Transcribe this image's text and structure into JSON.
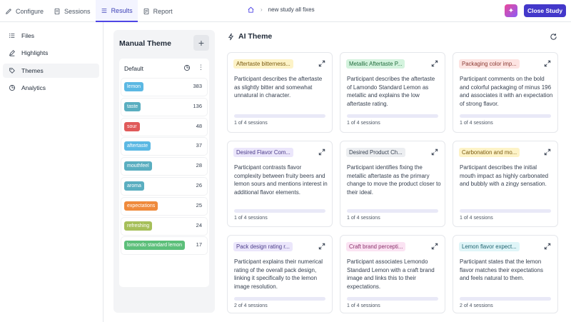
{
  "nav": {
    "tabs": [
      {
        "label": "Configure"
      },
      {
        "label": "Sessions"
      },
      {
        "label": "Results"
      },
      {
        "label": "Report"
      }
    ]
  },
  "breadcrumb": {
    "study": "new study all fixes"
  },
  "header": {
    "close_label": "Close Study"
  },
  "sidebar": {
    "items": [
      {
        "label": "Files"
      },
      {
        "label": "Highlights"
      },
      {
        "label": "Themes"
      },
      {
        "label": "Analytics"
      }
    ]
  },
  "manual": {
    "title": "Manual Theme",
    "add": "+",
    "group": "Default",
    "tags": [
      {
        "label": "lemon",
        "count": "383",
        "color": "#5bb8e3"
      },
      {
        "label": "taste",
        "count": "136",
        "color": "#5aaec0"
      },
      {
        "label": "sour",
        "count": "48",
        "color": "#e05a5a"
      },
      {
        "label": "aftertaste",
        "count": "37",
        "color": "#5bb8e3"
      },
      {
        "label": "mouthfeel",
        "count": "28",
        "color": "#5aaec0"
      },
      {
        "label": "aroma",
        "count": "26",
        "color": "#5aaec0"
      },
      {
        "label": "expectations",
        "count": "25",
        "color": "#ef8a3c"
      },
      {
        "label": "refreshing",
        "count": "24",
        "color": "#a6bf5a"
      },
      {
        "label": "lomondo standard lemon",
        "count": "17",
        "color": "#5cbf7a"
      }
    ]
  },
  "ai": {
    "title": "AI Theme",
    "cards": [
      {
        "label": "Aftertaste bitterness...",
        "label_bg": "#fdf3c7",
        "label_color": "#7a5a10",
        "desc": "Participant describes the aftertaste as slightly bitter and somewhat unnatural in character.",
        "sessions": "1 of 4 sessions"
      },
      {
        "label": "Metallic Aftertaste P...",
        "label_bg": "#d4f3de",
        "label_color": "#1f6b3b",
        "desc": "Participant describes the aftertaste of Lamondo Standard Lemon as metallic and explains the low aftertaste rating.",
        "sessions": "1 of 4 sessions"
      },
      {
        "label": "Packaging color imp...",
        "label_bg": "#fde4e2",
        "label_color": "#8a3a33",
        "desc": "Participant comments on the bold and colorful packaging of minus 196 and associates it with an expectation of strong flavor.",
        "sessions": "1 of 4 sessions"
      },
      {
        "label": "Desired Flavor Com...",
        "label_bg": "#ebe6fb",
        "label_color": "#4b3c8a",
        "desc": "Participant contrasts flavor complexity between fruity beers and lemon sours and mentions interest in additional flavor elements.",
        "sessions": "1 of 4 sessions"
      },
      {
        "label": "Desired Product Ch...",
        "label_bg": "#eceef1",
        "label_color": "#374151",
        "desc": "Participant identifies fixing the metallic aftertaste as the primary change to move the product closer to their ideal.",
        "sessions": "1 of 4 sessions"
      },
      {
        "label": "Carbonation and mo...",
        "label_bg": "#fdf3c7",
        "label_color": "#7a5a10",
        "desc": "Participant describes the initial mouth impact as highly carbonated and bubbly with a zingy sensation.",
        "sessions": "1 of 4 sessions"
      },
      {
        "label": "Pack design rating r...",
        "label_bg": "#ebe6fb",
        "label_color": "#4b3c8a",
        "desc": "Participant explains their numerical rating of the overall pack design, linking it specifically to the lemon image resolution.",
        "sessions": "2 of 4 sessions"
      },
      {
        "label": "Craft brand percepti...",
        "label_bg": "#fbe3f3",
        "label_color": "#8a2f6a",
        "desc": "Participant associates Lemondo Standard Lemon with a craft brand image and links this to their expectations.",
        "sessions": "1 of 4 sessions"
      },
      {
        "label": "Lemon flavor expect...",
        "label_bg": "#dff5f8",
        "label_color": "#1f6470",
        "desc": "Participant states that the lemon flavor matches their expectations and feels natural to them.",
        "sessions": "2 of 4 sessions"
      }
    ]
  }
}
